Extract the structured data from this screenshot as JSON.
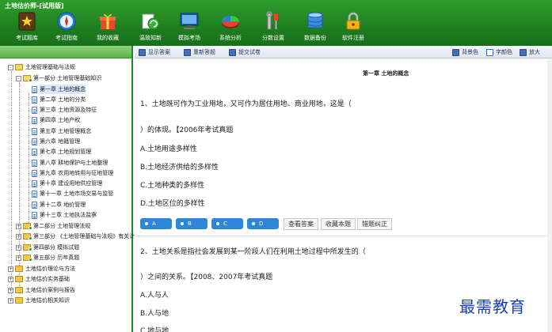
{
  "app": {
    "title": "土地估价师-[试用版]"
  },
  "toolbar": {
    "items": [
      {
        "label": "考试题库",
        "icon": "star-book-icon"
      },
      {
        "label": "考试指南",
        "icon": "compass-icon"
      },
      {
        "label": "我的收藏",
        "icon": "gift-box-icon"
      },
      {
        "label": "温故知新",
        "icon": "recycle-icon"
      },
      {
        "label": "模拟考场",
        "icon": "monitor-icon"
      },
      {
        "label": "系统分析",
        "icon": "pie-chart-icon"
      },
      {
        "label": "分数设置",
        "icon": "tools-icon"
      },
      {
        "label": "数据备份",
        "icon": "database-icon"
      },
      {
        "label": "软件注册",
        "icon": "padlock-icon"
      }
    ]
  },
  "tree": {
    "root1": "土地管理基础与法规",
    "part1": "第一部分 土地管理基础知识",
    "chapters": [
      "第一章 土地的概念",
      "第二章 土地的分类",
      "第三章 土地资源及特征",
      "第四章 土地产权",
      "第五章 土地管理概念",
      "第六章 地籍管理",
      "第七章 土地规划管理",
      "第八章 耕地保护与土地整理",
      "第九章 农用地转用与征地管理",
      "第十章 建设用地供应管理",
      "第十一章 土地市场交易与监管",
      "第十二章 地价管理",
      "第十三章 土地执法监察"
    ],
    "parts": [
      "第二部分 土地管理法规",
      "第三部分 《土地管理基础与法规》有关计算题",
      "第四部分 模拟试题",
      "第五部分 历年真题"
    ],
    "roots": [
      "土地估价理论与方法",
      "土地估价实务基础",
      "土地估价案例与报告",
      "土地估价相关知识"
    ]
  },
  "content_toolbar": {
    "show_answer": "显示答案",
    "redo": "重新答题",
    "submit": "提交试卷",
    "bg_color": "背景色",
    "font_color": "字颜色",
    "zoom": "放大"
  },
  "content": {
    "chapter_title": "第一章 土地的概念",
    "q1": {
      "line1": "1、土地既可作为工业用地，又可作为居住用地、商业用地，这是（",
      "line2": "）的体现。【2006年考试真题",
      "options": [
        "A.土地用途多样性",
        "B.土地经济供给的多样性",
        "C.土地种类的多样性",
        "D.土地区位的多样性"
      ]
    },
    "answer_buttons": [
      "A",
      "B",
      "C",
      "D"
    ],
    "actions": [
      "查看答案",
      "收藏本题",
      "错题纠正"
    ],
    "q2": {
      "line1": "2、土地关系是指社会发展到某一阶段人们在利用土地过程中所发生的（",
      "line2": "）之间的关系。【2008、2007年考试真题",
      "options": [
        "A.人与人",
        "B.人与地",
        "C.地与地"
      ]
    }
  },
  "watermark": "最需教育"
}
